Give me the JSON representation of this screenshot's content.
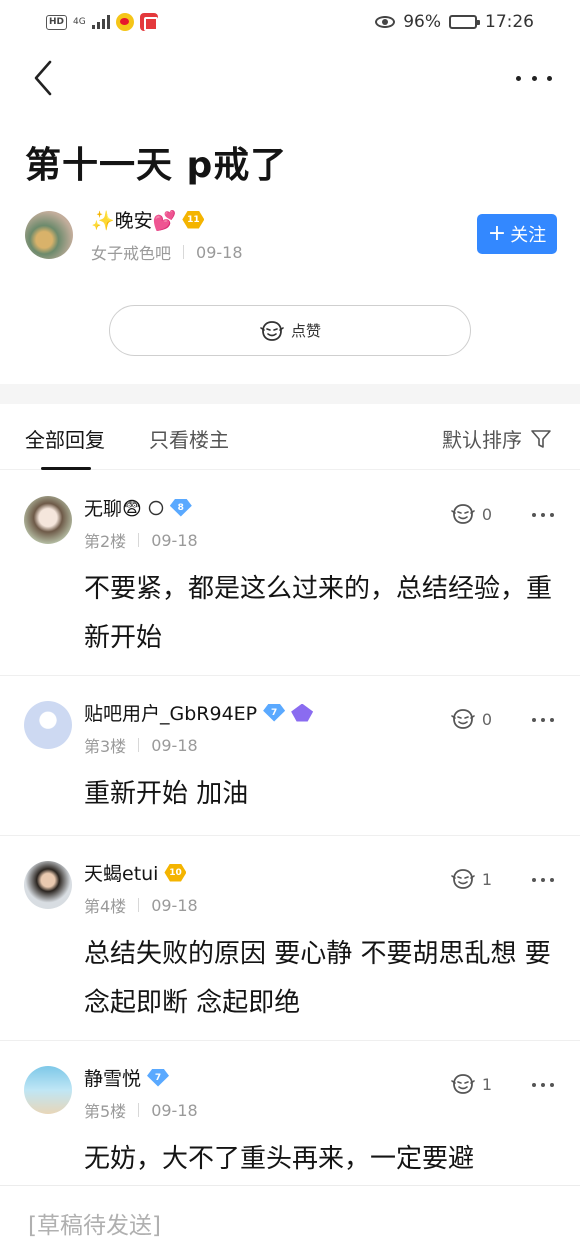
{
  "status_bar": {
    "hd": "HD",
    "network": "4G",
    "battery": "96%",
    "battery_level": 0.96,
    "time": "17:26"
  },
  "post": {
    "title": "第十一天 p戒了",
    "author": {
      "name": "✨晚安💕",
      "level": "11",
      "forum": "女子戒色吧",
      "date": "09-18"
    },
    "follow_label": "关注",
    "follow_plus": "+",
    "like_label": "点赞"
  },
  "tabs": {
    "all": "全部回复",
    "owner_only": "只看楼主",
    "sort": "默认排序"
  },
  "replies": [
    {
      "name": "无聊😨",
      "level": "8",
      "floor": "第2楼",
      "date": "09-18",
      "likes": "0",
      "text": "不要紧，都是这么过来的，总结经验，重新开始"
    },
    {
      "name": "贴吧用户_GbR94EP",
      "level": "7",
      "floor": "第3楼",
      "date": "09-18",
      "likes": "0",
      "text": "重新开始 加油"
    },
    {
      "name": "天蝎etui",
      "level": "10",
      "floor": "第4楼",
      "date": "09-18",
      "likes": "1",
      "text": "总结失败的原因 要心静 不要胡思乱想 要念起即断 念起即绝"
    },
    {
      "name": "静雪悦",
      "level": "7",
      "floor": "第5楼",
      "date": "09-18",
      "likes": "1",
      "text": "无妨，大不了重头再来，一定要避"
    }
  ],
  "bottom": {
    "draft": "[草稿待发送]"
  },
  "colors": {
    "accent": "#3388ff",
    "meta": "#9a9a9a"
  },
  "icons": [
    "back-arrow-icon",
    "more-dots-icon",
    "like-face-icon",
    "filter-funnel-icon"
  ]
}
